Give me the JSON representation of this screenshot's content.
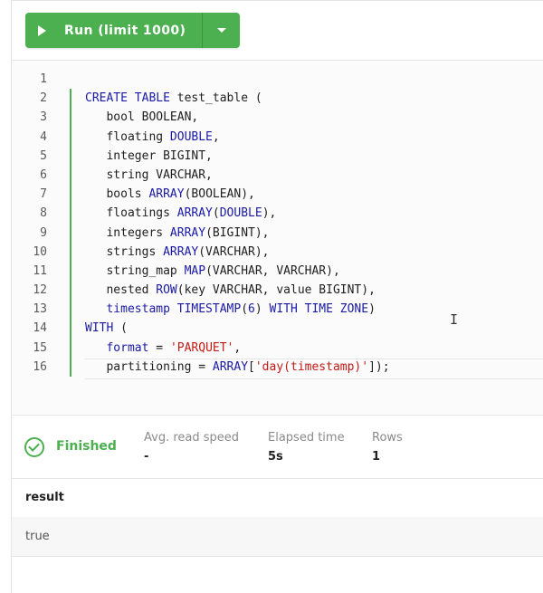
{
  "toolbar": {
    "run_label": "Run (limit 1000)"
  },
  "editor": {
    "line_numbers": [
      "1",
      "2",
      "3",
      "4",
      "5",
      "6",
      "7",
      "8",
      "9",
      "10",
      "11",
      "12",
      "13",
      "14",
      "15",
      "16"
    ],
    "lines": [
      [],
      [
        [
          "kw",
          "CREATE TABLE"
        ],
        [
          "t",
          " test_table ("
        ]
      ],
      [
        [
          "t",
          "   bool BOOLEAN,"
        ]
      ],
      [
        [
          "t",
          "   floating "
        ],
        [
          "kw",
          "DOUBLE"
        ],
        [
          "t",
          ","
        ]
      ],
      [
        [
          "t",
          "   integer BIGINT,"
        ]
      ],
      [
        [
          "t",
          "   string VARCHAR,"
        ]
      ],
      [
        [
          "t",
          "   bools "
        ],
        [
          "kw",
          "ARRAY"
        ],
        [
          "t",
          "(BOOLEAN),"
        ]
      ],
      [
        [
          "t",
          "   floatings "
        ],
        [
          "kw",
          "ARRAY"
        ],
        [
          "t",
          "("
        ],
        [
          "kw",
          "DOUBLE"
        ],
        [
          "t",
          "),"
        ]
      ],
      [
        [
          "t",
          "   integers "
        ],
        [
          "kw",
          "ARRAY"
        ],
        [
          "t",
          "(BIGINT),"
        ]
      ],
      [
        [
          "t",
          "   strings "
        ],
        [
          "kw",
          "ARRAY"
        ],
        [
          "t",
          "(VARCHAR),"
        ]
      ],
      [
        [
          "t",
          "   string_map "
        ],
        [
          "kw",
          "MAP"
        ],
        [
          "t",
          "(VARCHAR, VARCHAR),"
        ]
      ],
      [
        [
          "t",
          "   nested "
        ],
        [
          "kw",
          "ROW"
        ],
        [
          "t",
          "(key VARCHAR, value BIGINT),"
        ]
      ],
      [
        [
          "t",
          "   "
        ],
        [
          "kw",
          "timestamp TIMESTAMP"
        ],
        [
          "t",
          "("
        ],
        [
          "kw",
          "6"
        ],
        [
          "t",
          ") "
        ],
        [
          "kw",
          "WITH TIME ZONE"
        ],
        [
          "t",
          ")"
        ]
      ],
      [
        [
          "kw",
          "WITH"
        ],
        [
          "t",
          " ("
        ]
      ],
      [
        [
          "t",
          "   "
        ],
        [
          "kw",
          "format"
        ],
        [
          "t",
          " = "
        ],
        [
          "str",
          "'PARQUET'"
        ],
        [
          "t",
          ","
        ]
      ],
      [
        [
          "t",
          "   partitioning = "
        ],
        [
          "kw",
          "ARRAY"
        ],
        [
          "t",
          "["
        ],
        [
          "str",
          "'day(timestamp)'"
        ],
        [
          "t",
          "]);"
        ]
      ]
    ]
  },
  "status": {
    "state": "Finished",
    "metrics": [
      {
        "label": "Avg. read speed",
        "value": "-"
      },
      {
        "label": "Elapsed time",
        "value": "5s"
      },
      {
        "label": "Rows",
        "value": "1"
      }
    ]
  },
  "results": {
    "column": "result",
    "rows": [
      "true"
    ]
  },
  "colors": {
    "accent": "#4caf50",
    "keyword": "#1a1aa6",
    "string": "#c41a16"
  }
}
